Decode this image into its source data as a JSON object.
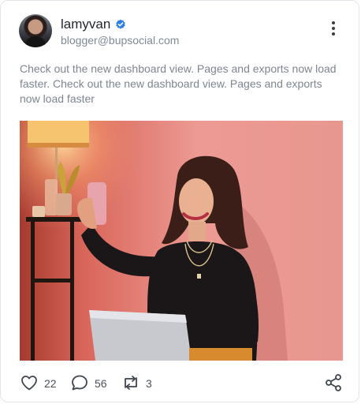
{
  "post": {
    "author": {
      "name": "lamyvan",
      "handle": "blogger@bupsocial.com",
      "verified_color": "#2f7fe6"
    },
    "text": "Check out the new dashboard view. Pages and exports now load faster. Check out the new dashboard view. Pages and exports now load faster",
    "stats": {
      "likes": "22",
      "comments": "56",
      "reposts": "3"
    },
    "icons": {
      "like": "heart-icon",
      "comment": "comment-icon",
      "repost": "repost-icon",
      "share": "share-icon",
      "more": "more-vertical-icon",
      "verified": "verified-badge-icon"
    }
  }
}
